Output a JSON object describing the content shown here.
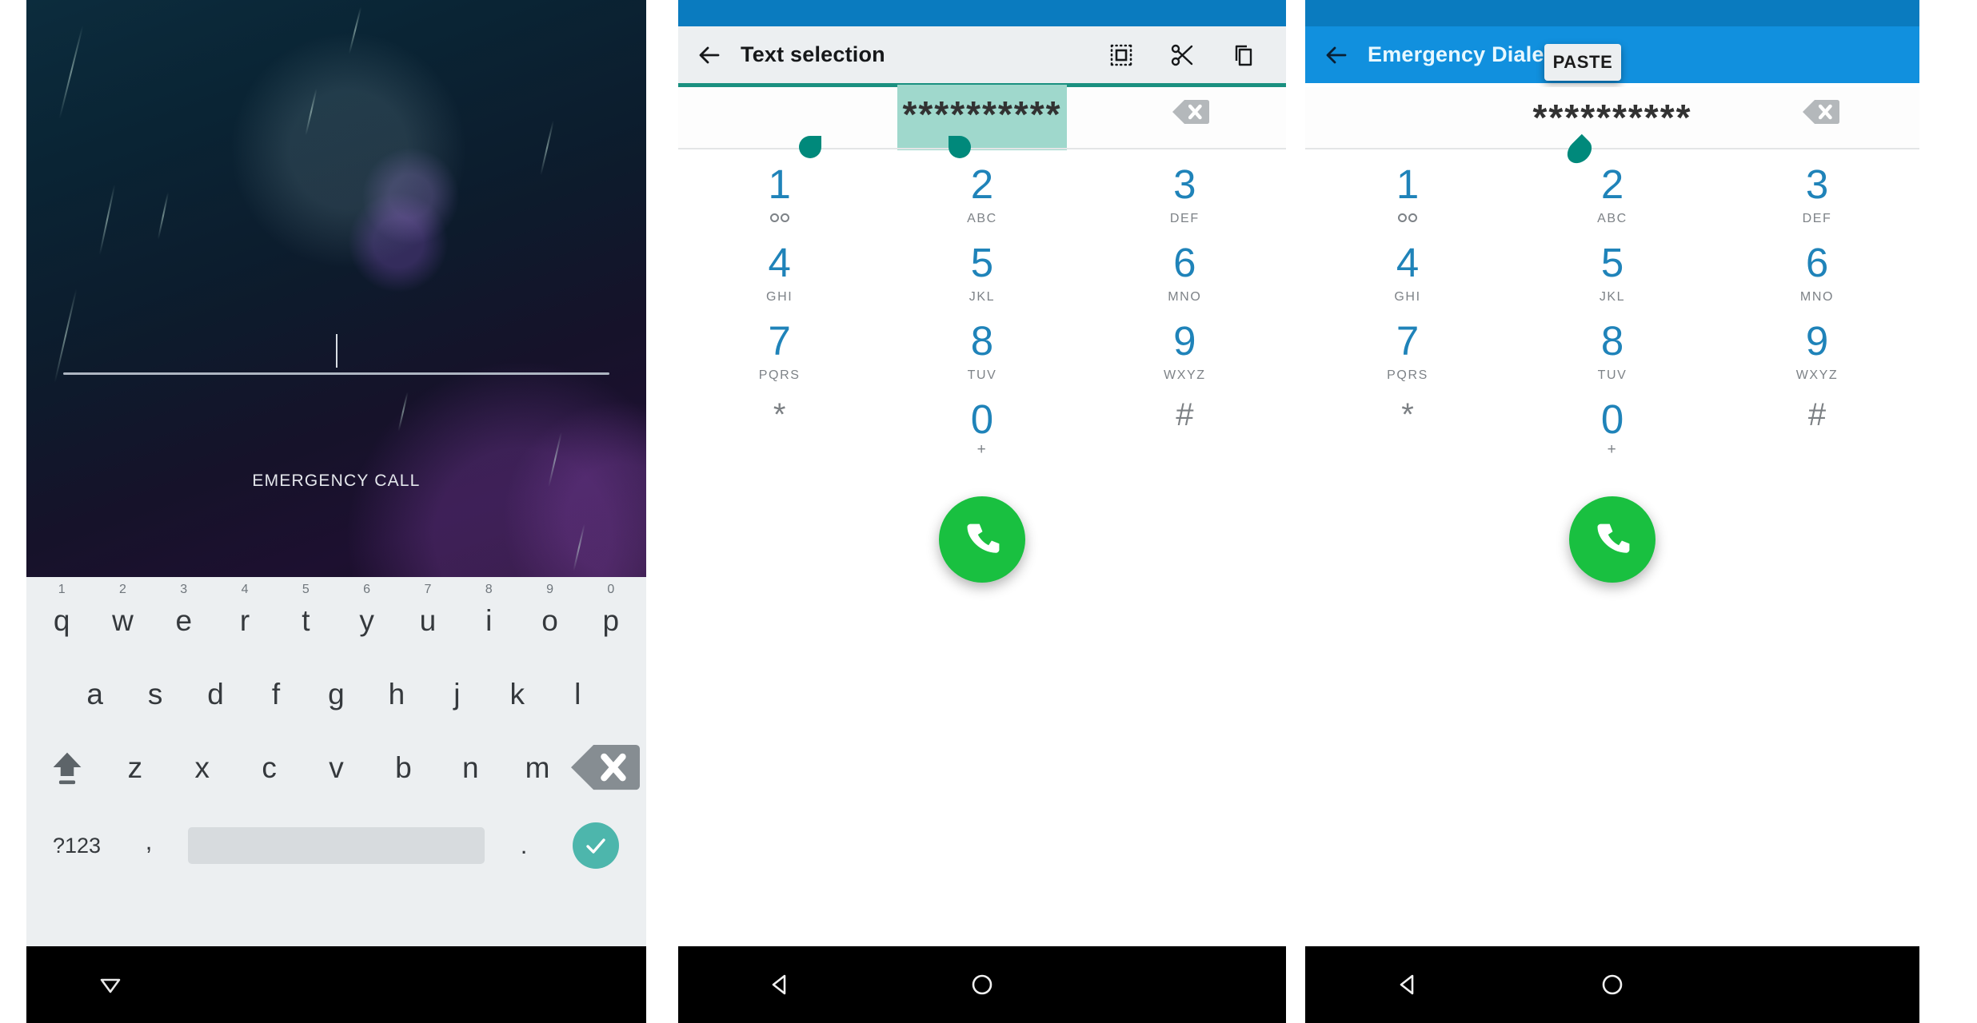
{
  "panels": {
    "lockscreen": {
      "emergency_label": "EMERGENCY CALL",
      "keyboard": {
        "row1_letters": [
          "q",
          "w",
          "e",
          "r",
          "t",
          "y",
          "u",
          "i",
          "o",
          "p"
        ],
        "row1_numbers": [
          "1",
          "2",
          "3",
          "4",
          "5",
          "6",
          "7",
          "8",
          "9",
          "0"
        ],
        "row2_letters": [
          "a",
          "s",
          "d",
          "f",
          "g",
          "h",
          "j",
          "k",
          "l"
        ],
        "row3_letters": [
          "z",
          "x",
          "c",
          "v",
          "b",
          "n",
          "m"
        ],
        "symbols_key": "?123",
        "comma_key": ",",
        "period_key": ".",
        "shift_icon": "shift-icon",
        "delete_icon": "backspace-icon",
        "enter_icon": "check-icon",
        "space_key": ""
      },
      "nav": {
        "back_icon": "collapse-keyboard-icon"
      }
    },
    "text_selection": {
      "statusbar_color": "#0a7bbf",
      "actionbar_color": "#eceff1",
      "accent_color": "#1a9080",
      "title": "Text selection",
      "back_icon": "back-arrow-icon",
      "actions": [
        {
          "name": "select-all-icon",
          "label": "Select all"
        },
        {
          "name": "cut-icon",
          "label": "Cut"
        },
        {
          "name": "copy-icon",
          "label": "Copy"
        }
      ],
      "number_value": "**********",
      "clear_icon": "backspace-clear-icon",
      "selection_handles": [
        "left-selection-handle",
        "right-selection-handle"
      ],
      "nav": {
        "back_icon": "nav-back-icon",
        "home_icon": "nav-home-icon"
      }
    },
    "emergency_dialer": {
      "statusbar_color": "#0a7bbf",
      "actionbar_color": "#1190de",
      "title": "Emergency Dialer",
      "back_icon": "back-arrow-icon",
      "paste_label": "PASTE",
      "number_value": "**********",
      "clear_icon": "backspace-clear-icon",
      "cursor_handle": "text-cursor-handle",
      "nav": {
        "back_icon": "nav-back-icon",
        "home_icon": "nav-home-icon"
      }
    }
  },
  "dialpad": {
    "keys": [
      {
        "digit": "1",
        "sub": "",
        "sub_type": "voicemail"
      },
      {
        "digit": "2",
        "sub": "ABC",
        "sub_type": "letters"
      },
      {
        "digit": "3",
        "sub": "DEF",
        "sub_type": "letters"
      },
      {
        "digit": "4",
        "sub": "GHI",
        "sub_type": "letters"
      },
      {
        "digit": "5",
        "sub": "JKL",
        "sub_type": "letters"
      },
      {
        "digit": "6",
        "sub": "MNO",
        "sub_type": "letters"
      },
      {
        "digit": "7",
        "sub": "PQRS",
        "sub_type": "letters"
      },
      {
        "digit": "8",
        "sub": "TUV",
        "sub_type": "letters"
      },
      {
        "digit": "9",
        "sub": "WXYZ",
        "sub_type": "letters"
      },
      {
        "digit": "*",
        "sub": "",
        "sub_type": "none"
      },
      {
        "digit": "0",
        "sub": "+",
        "sub_type": "plus"
      },
      {
        "digit": "#",
        "sub": "",
        "sub_type": "none"
      }
    ],
    "call_icon": "phone-call-icon",
    "call_button_color": "#19c040"
  }
}
